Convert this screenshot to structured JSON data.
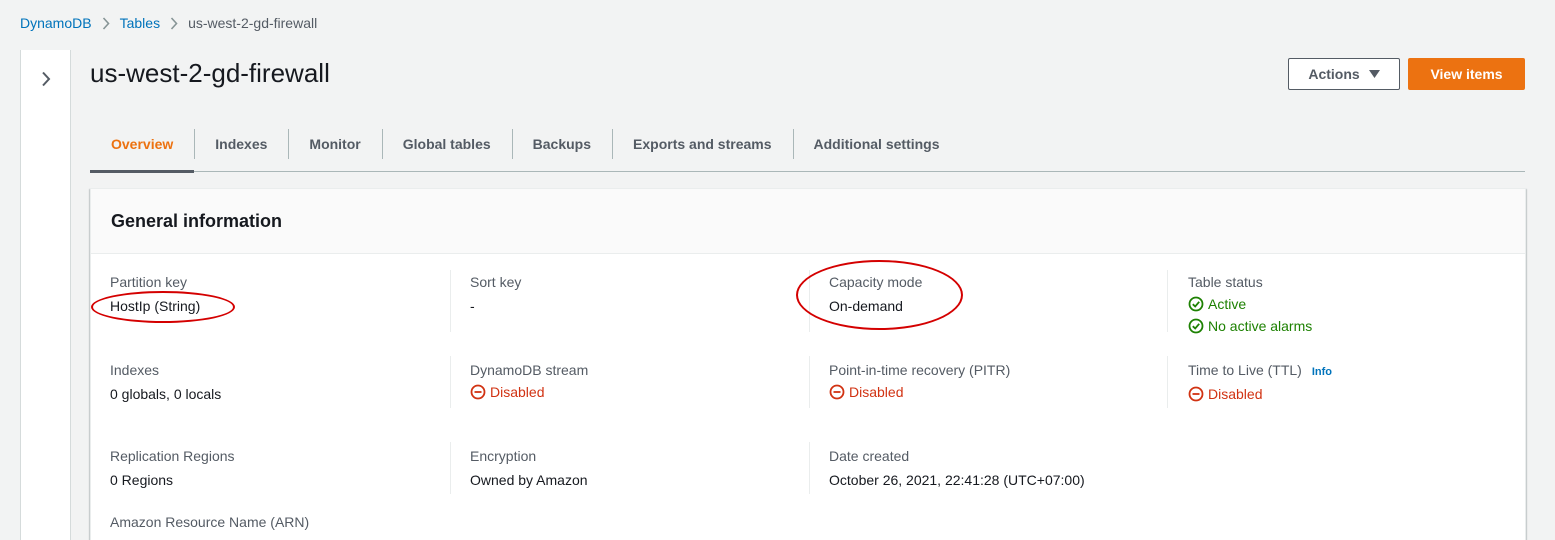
{
  "breadcrumb": {
    "items": [
      "DynamoDB",
      "Tables"
    ],
    "current": "us-west-2-gd-firewall"
  },
  "header": {
    "title": "us-west-2-gd-firewall",
    "actions_label": "Actions",
    "view_items_label": "View items"
  },
  "tabs": [
    {
      "label": "Overview",
      "active": true
    },
    {
      "label": "Indexes"
    },
    {
      "label": "Monitor"
    },
    {
      "label": "Global tables"
    },
    {
      "label": "Backups"
    },
    {
      "label": "Exports and streams"
    },
    {
      "label": "Additional settings"
    }
  ],
  "general": {
    "title": "General information",
    "partition_key": {
      "label": "Partition key",
      "value": "HostIp (String)"
    },
    "sort_key": {
      "label": "Sort key",
      "value": "-"
    },
    "capacity_mode": {
      "label": "Capacity mode",
      "value": "On-demand"
    },
    "table_status": {
      "label": "Table status",
      "status": "Active",
      "alarms": "No active alarms"
    },
    "indexes": {
      "label": "Indexes",
      "value": "0 globals, 0 locals"
    },
    "stream": {
      "label": "DynamoDB stream",
      "value": "Disabled"
    },
    "pitr": {
      "label": "Point-in-time recovery (PITR)",
      "value": "Disabled"
    },
    "ttl": {
      "label": "Time to Live (TTL)",
      "info": "Info",
      "value": "Disabled"
    },
    "replication": {
      "label": "Replication Regions",
      "value": "0 Regions"
    },
    "encryption": {
      "label": "Encryption",
      "value": "Owned by Amazon"
    },
    "date_created": {
      "label": "Date created",
      "value": "October 26, 2021, 22:41:28 (UTC+07:00)"
    },
    "arn": {
      "label": "Amazon Resource Name (ARN)"
    }
  },
  "colors": {
    "accent": "#ec7211",
    "link": "#0073bb",
    "success": "#1d8102",
    "error": "#d13212",
    "annotation": "#d40000"
  }
}
